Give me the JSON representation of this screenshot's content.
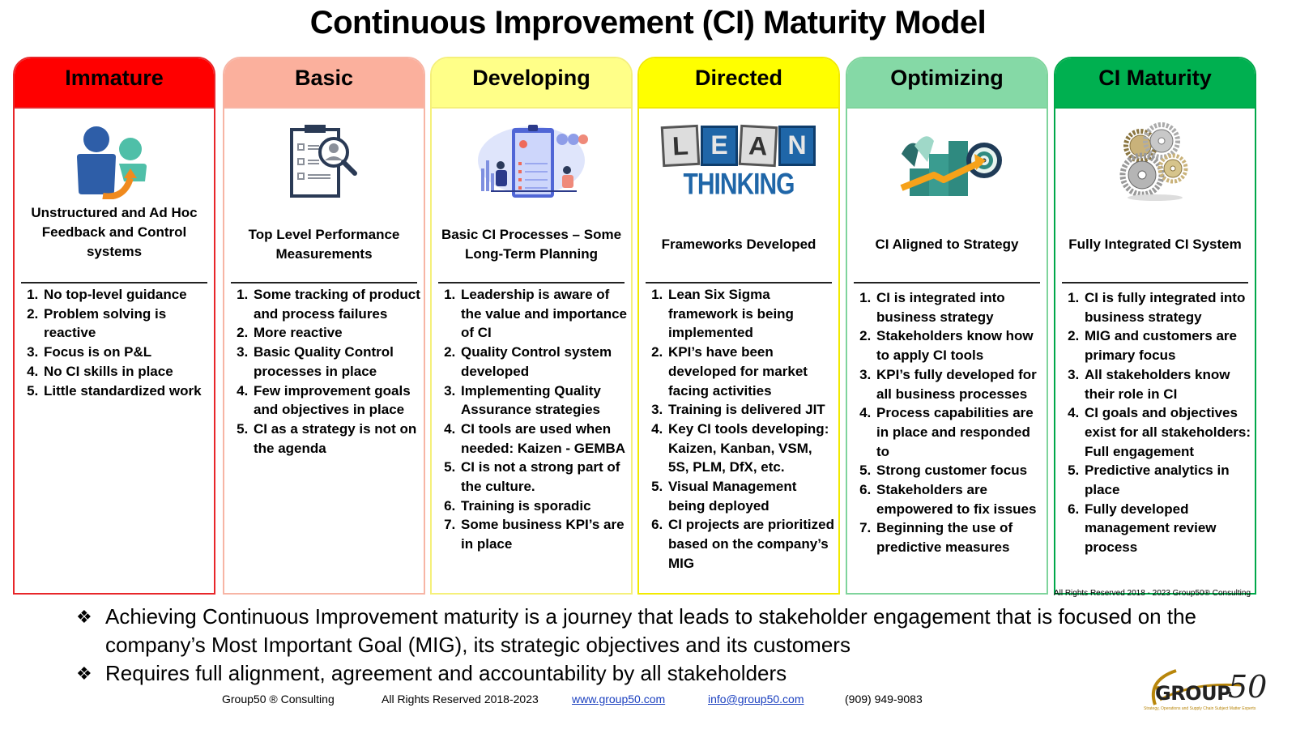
{
  "title": "Continuous Improvement (CI) Maturity Model",
  "stages": [
    {
      "name": "Immature",
      "header_color": "#ff0000",
      "border_color": "#e8262a",
      "icon": "people-feedback-icon",
      "subtitle": "Unstructured and Ad Hoc Feedback and Control systems",
      "items": [
        "No top-level guidance",
        "Problem solving is reactive",
        "Focus is on P&L",
        "No CI skills in place",
        "Little standardized work"
      ]
    },
    {
      "name": "Basic",
      "header_color": "#fbb09d",
      "border_color": "#f7b5a5",
      "icon": "clipboard-search-icon",
      "subtitle": "Top Level Performance Measurements",
      "items": [
        "Some tracking of product and process failures",
        "More reactive",
        "Basic Quality Control processes in place",
        "Few improvement goals and objectives in place",
        "CI as a strategy is not on the agenda"
      ]
    },
    {
      "name": "Developing",
      "header_color": "#ffff88",
      "border_color": "#f5f07a",
      "icon": "planning-meeting-icon",
      "subtitle": "Basic CI Processes – Some Long-Term Planning",
      "items": [
        "Leadership is aware of the value and importance of CI",
        "Quality Control system developed",
        "Implementing Quality Assurance strategies",
        "CI tools are used when needed: Kaizen - GEMBA",
        "CI is not a strong part of the culture.",
        "Training is sporadic",
        "Some business KPI’s are in place"
      ]
    },
    {
      "name": "Directed",
      "header_color": "#ffff00",
      "border_color": "#f2ea00",
      "icon": "lean-thinking-icon",
      "icon_text": [
        "L",
        "E",
        "A",
        "N"
      ],
      "icon_caption": "THINKING",
      "subtitle": "Frameworks Developed",
      "items": [
        "Lean Six Sigma framework is being implemented",
        "KPI’s have been developed for market facing activities",
        "Training is delivered JIT",
        "Key CI tools developing: Kaizen, Kanban, VSM, 5S, PLM, DfX, etc.",
        "Visual Management being deployed",
        "CI projects are prioritized based on the company’s MIG"
      ]
    },
    {
      "name": "Optimizing",
      "header_color": "#85d9a6",
      "border_color": "#7fd49c",
      "icon": "strategy-target-icon",
      "subtitle": "CI Aligned to Strategy",
      "items": [
        "CI is integrated into business strategy",
        "Stakeholders know how to apply CI tools",
        "KPI’s fully developed for all business processes",
        "Process capabilities are in place and responded to",
        "Strong customer focus",
        "Stakeholders are empowered to fix issues",
        "Beginning the use of predictive measures"
      ]
    },
    {
      "name": "CI Maturity",
      "header_color": "#00b050",
      "border_color": "#00a84a",
      "icon": "gears-icon",
      "subtitle": "Fully Integrated CI System",
      "items": [
        "CI is fully integrated into business strategy",
        "MIG and customers are primary focus",
        "All stakeholders know their role in CI",
        "CI goals and objectives exist for all stakeholders: Full engagement",
        "Predictive analytics in place",
        "Fully developed management review process"
      ]
    }
  ],
  "rights_small": "All Rights Reserved 2018 - 2023   Group50® Consulting",
  "bullets": [
    "Achieving Continuous Improvement maturity is a journey that leads to stakeholder engagement that is focused on the company’s Most Important Goal (MIG), its strategic objectives and its customers",
    "Requires full alignment, agreement and accountability by all stakeholders"
  ],
  "bullet_glyph": "❖",
  "footer": {
    "company": "Group50 ® Consulting",
    "rights": "All Rights Reserved 2018-2023",
    "website": "www.group50.com",
    "email": "info@group50.com",
    "phone": "(909) 949-9083"
  },
  "logo": {
    "word": "GROUP",
    "number": "50",
    "tagline": "Strategy, Operations and Supply Chain Subject Matter Experts"
  }
}
